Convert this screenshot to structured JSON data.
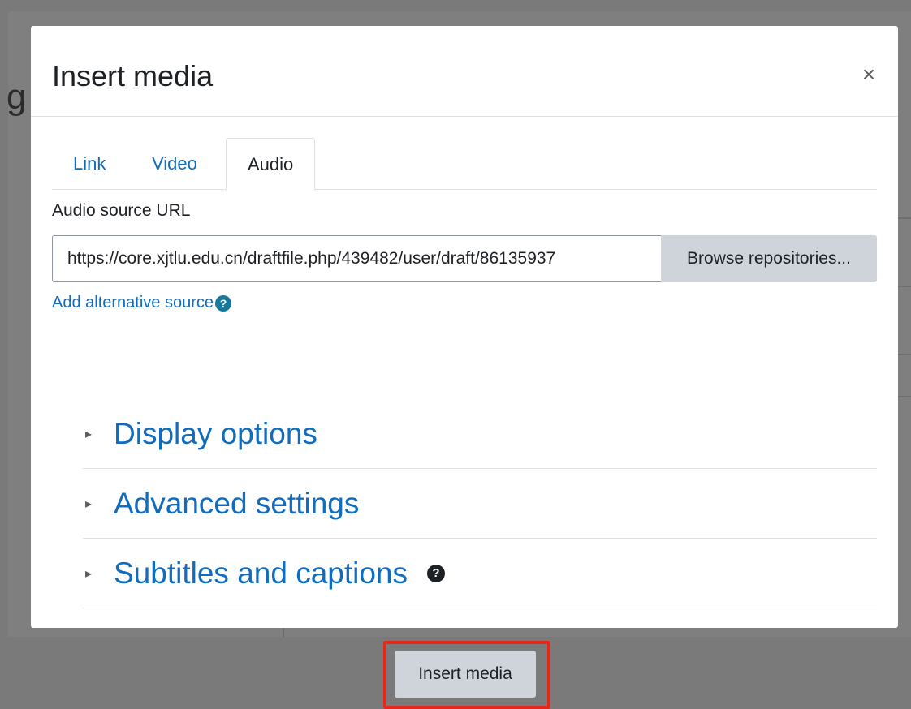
{
  "background": {
    "partial_letter": "g"
  },
  "modal": {
    "title": "Insert media",
    "close_label": "×"
  },
  "tabs": [
    {
      "label": "Link",
      "active": false
    },
    {
      "label": "Video",
      "active": false
    },
    {
      "label": "Audio",
      "active": true
    }
  ],
  "audio": {
    "source_label": "Audio source URL",
    "source_url": "https://core.xjtlu.edu.cn/draftfile.php/439482/user/draft/86135937",
    "browse_label": "Browse repositories...",
    "add_alternative_label": "Add alternative source",
    "help_icon_glyph": "?"
  },
  "sections": [
    {
      "label": "Display options",
      "caret": "▸"
    },
    {
      "label": "Advanced settings",
      "caret": "▸"
    },
    {
      "label": "Subtitles and captions",
      "caret": "▸"
    }
  ],
  "footer": {
    "insert_label": "Insert media"
  },
  "colors": {
    "link": "#0f6cbf",
    "button_bg": "#ced4da",
    "highlight": "#e8251a",
    "help_icon": "#16789b"
  }
}
